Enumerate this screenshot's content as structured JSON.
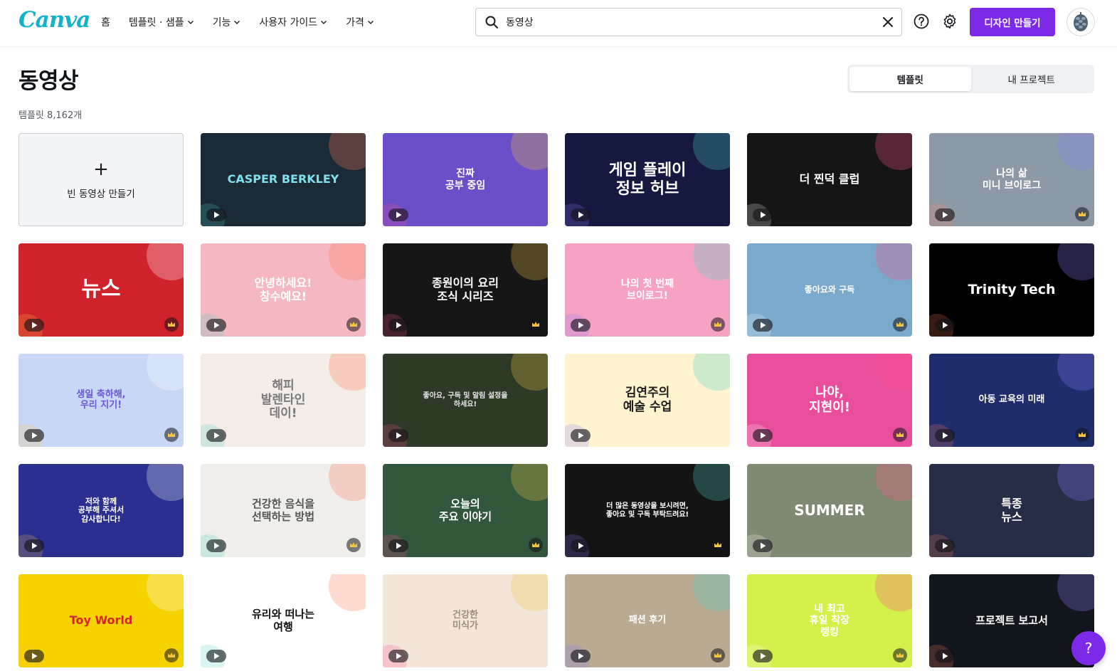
{
  "header": {
    "logo": "Canva",
    "nav": [
      {
        "label": "홈",
        "has_menu": false
      },
      {
        "label": "템플릿 · 샘플",
        "has_menu": true
      },
      {
        "label": "기능",
        "has_menu": true
      },
      {
        "label": "사용자 가이드",
        "has_menu": true
      },
      {
        "label": "가격",
        "has_menu": true
      }
    ],
    "search_value": "동영상",
    "create_label": "디자인 만들기"
  },
  "page": {
    "title": "동영상",
    "count_text": "템플릿 8,162개",
    "tabs": [
      {
        "label": "템플릿",
        "active": true
      },
      {
        "label": "내 프로젝트",
        "active": false
      }
    ]
  },
  "blank_card": {
    "label": "빈 동영상 만들기"
  },
  "templates": [
    {
      "title": "CASPER BERKLEY",
      "bg": "#1c2a35",
      "fg": "#7fe0ec",
      "size": 16,
      "pro": false
    },
    {
      "title": "진짜\n공부 중임",
      "bg": "#6a4fc8",
      "fg": "#ffffff",
      "size": 14,
      "pro": false
    },
    {
      "title": "게임 플레이\n정보 허브",
      "bg": "#16193f",
      "fg": "#ffffff",
      "size": 22,
      "pro": false
    },
    {
      "title": "더 찐덕 클럽",
      "bg": "#151515",
      "fg": "#ffffff",
      "size": 16,
      "pro": false
    },
    {
      "title": "나의 삶\n미니 브이로그",
      "bg": "#8d9aa6",
      "fg": "#ffffff",
      "size": 14,
      "pro": true
    },
    {
      "title": "뉴스",
      "bg": "#d0222a",
      "fg": "#ffffff",
      "size": 30,
      "pro": true
    },
    {
      "title": "안녕하세요!\n창수예요!",
      "bg": "#f6b8c0",
      "fg": "#ffffff",
      "size": 16,
      "pro": true
    },
    {
      "title": "종원이의 요리\n조식 시리즈",
      "bg": "#161616",
      "fg": "#ffffff",
      "size": 16,
      "pro": true
    },
    {
      "title": "나의 첫 번째\n브이로그!",
      "bg": "#f6a2c4",
      "fg": "#ffffff",
      "size": 14,
      "pro": true
    },
    {
      "title": "좋아요와 구독",
      "bg": "#7aa9cc",
      "fg": "#ffffff",
      "size": 12,
      "pro": true
    },
    {
      "title": "Trinity Tech",
      "bg": "#000000",
      "fg": "#ffffff",
      "size": 19,
      "pro": false
    },
    {
      "title": "생일 축하해,\n우리 지기!",
      "bg": "#c9d7f6",
      "fg": "#6b55d8",
      "size": 13,
      "pro": true
    },
    {
      "title": "해피\n발렌타인\n데이!",
      "bg": "#f4ece6",
      "fg": "#7a7a7a",
      "size": 17,
      "pro": false
    },
    {
      "title": "좋아요, 구독 및 알림 설정을\n하세요!",
      "bg": "#2e3a28",
      "fg": "#e4e4e4",
      "size": 10,
      "pro": false
    },
    {
      "title": "김연주의\n예술 수업",
      "bg": "#fff4cf",
      "fg": "#1e1e1e",
      "size": 17,
      "pro": false
    },
    {
      "title": "나야,\n지현이!",
      "bg": "#e94e9c",
      "fg": "#ffffff",
      "size": 18,
      "pro": true
    },
    {
      "title": "아동 교육의 미래",
      "bg": "#1f2d6c",
      "fg": "#ffffff",
      "size": 13,
      "pro": true
    },
    {
      "title": "저와 함께\n공부해 주셔서\n감사합니다!",
      "bg": "#2b2f8f",
      "fg": "#ffffff",
      "size": 11,
      "pro": false
    },
    {
      "title": "건강한 음식을\n선택하는 방법",
      "bg": "#efeeea",
      "fg": "#555555",
      "size": 15,
      "pro": true
    },
    {
      "title": "오늘의\n주요 이야기",
      "bg": "#31573c",
      "fg": "#ffffff",
      "size": 15,
      "pro": true
    },
    {
      "title": "더 많은 동영상을 보시려면,\n좋아요 및 구독 부탁드려요!",
      "bg": "#141414",
      "fg": "#ffffff",
      "size": 10,
      "pro": true
    },
    {
      "title": "SUMMER",
      "bg": "#7f8a72",
      "fg": "#ffffff",
      "size": 20,
      "pro": false
    },
    {
      "title": "특종\n뉴스",
      "bg": "#262e47",
      "fg": "#ffffff",
      "size": 16,
      "pro": false
    },
    {
      "title": "Toy World",
      "bg": "#f6d200",
      "fg": "#d6262c",
      "size": 16,
      "pro": true
    },
    {
      "title": "유리와 떠나는\n여행",
      "bg": "#ffffff",
      "fg": "#111111",
      "size": 15,
      "pro": false
    },
    {
      "title": "건강한\n미식가",
      "bg": "#f2e6da",
      "fg": "#9a8d80",
      "size": 13,
      "pro": false
    },
    {
      "title": "패션 후기",
      "bg": "#b9ab92",
      "fg": "#ffffff",
      "size": 13,
      "pro": true
    },
    {
      "title": "내 최고\n휴일 착장\n랭킹",
      "bg": "#d4f04a",
      "fg": "#ffffff",
      "size": 14,
      "pro": true
    },
    {
      "title": "프로젝트 보고서",
      "bg": "#12161d",
      "fg": "#ffffff",
      "size": 15,
      "pro": false
    }
  ],
  "help": {
    "label": "?"
  },
  "icons": {
    "search": "search-icon",
    "clear": "close-icon",
    "help": "question-circle-icon",
    "settings": "gear-icon",
    "play": "play-icon",
    "pro": "crown-icon"
  },
  "colors": {
    "brand_purple": "#7d2ae8",
    "logo_teal": "#12b3c8"
  }
}
